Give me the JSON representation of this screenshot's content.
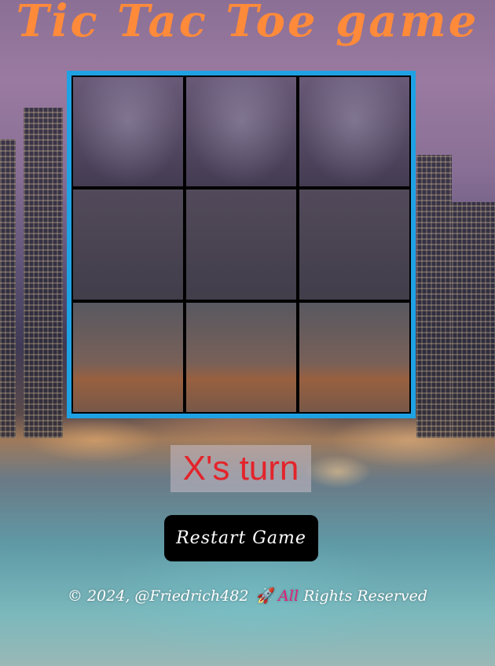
{
  "title": "Tic Tac Toe game",
  "board": {
    "cells": [
      "",
      "",
      "",
      "",
      "",
      "",
      "",
      "",
      ""
    ]
  },
  "status": "X's turn",
  "restart_label": "Restart Game",
  "footer": {
    "copyright": "© 2024, @Friedrich482",
    "rocket_icon": "rocket-icon",
    "all": "All",
    "rest": "Rights Reserved"
  },
  "colors": {
    "title": "#ff8a3a",
    "board_border": "#1fa2e4",
    "status_text": "#e3242b",
    "button_bg": "#000000",
    "footer_all": "#e0207a"
  }
}
